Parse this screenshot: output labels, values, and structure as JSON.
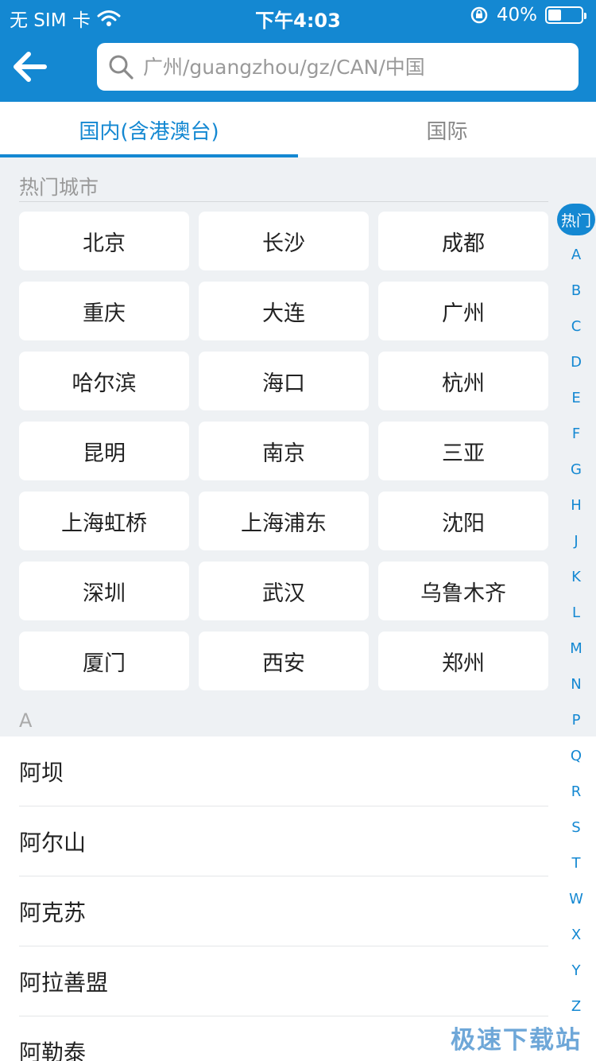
{
  "status_bar": {
    "carrier": "无 SIM 卡",
    "time": "下午4:03",
    "battery": "40%",
    "battery_level": 0.4
  },
  "header": {
    "back_icon": "arrow-left-icon",
    "search_icon": "search-icon",
    "search_placeholder": "广州/guangzhou/gz/CAN/中国",
    "accent_color": "#1488d2"
  },
  "tabs": [
    {
      "label": "国内(含港澳台)",
      "active": true
    },
    {
      "label": "国际",
      "active": false
    }
  ],
  "hot": {
    "title": "热门城市",
    "cities": [
      "北京",
      "长沙",
      "成都",
      "重庆",
      "大连",
      "广州",
      "哈尔滨",
      "海口",
      "杭州",
      "昆明",
      "南京",
      "三亚",
      "上海虹桥",
      "上海浦东",
      "沈阳",
      "深圳",
      "武汉",
      "乌鲁木齐",
      "厦门",
      "西安",
      "郑州"
    ]
  },
  "section_a": {
    "letter": "A",
    "items": [
      "阿坝",
      "阿尔山",
      "阿克苏",
      "阿拉善盟",
      "阿勒泰"
    ]
  },
  "index_bar": {
    "hot": "热门",
    "letters": [
      "A",
      "B",
      "C",
      "D",
      "E",
      "F",
      "G",
      "H",
      "J",
      "K",
      "L",
      "M",
      "N",
      "P",
      "Q",
      "R",
      "S",
      "T",
      "W",
      "X",
      "Y",
      "Z"
    ]
  },
  "watermark": "极速下载站"
}
